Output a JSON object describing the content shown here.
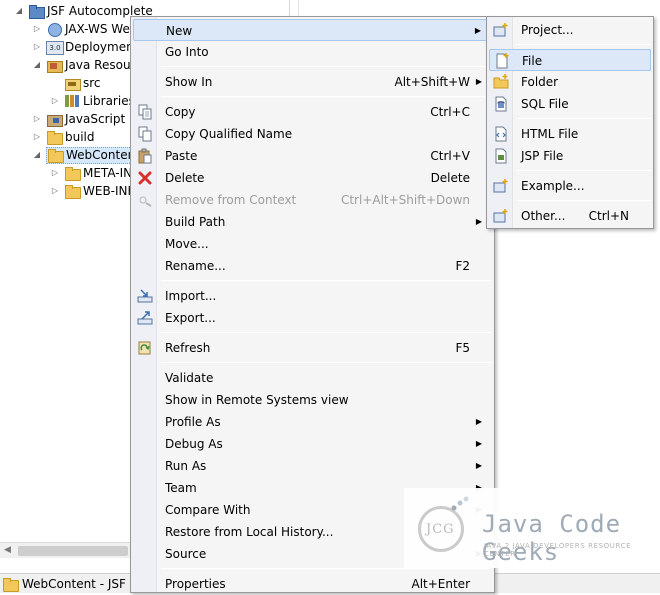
{
  "explorer": {
    "items": [
      {
        "label": "JSF Autocomplete",
        "icon": "project-icon",
        "expanded": true
      },
      {
        "label": "JAX-WS Web",
        "icon": "web-service-icon",
        "expanded": false
      },
      {
        "label": "Deployment",
        "icon": "deployment-descriptor-icon",
        "expanded": false
      },
      {
        "label": "Java Resourc",
        "icon": "java-resources-icon",
        "expanded": true
      },
      {
        "label": "src",
        "icon": "source-folder-icon",
        "expanded": null
      },
      {
        "label": "Libraries",
        "icon": "libraries-icon",
        "expanded": false
      },
      {
        "label": "JavaScript R",
        "icon": "javascript-resources-icon",
        "expanded": false
      },
      {
        "label": "build",
        "icon": "folder-icon",
        "expanded": false
      },
      {
        "label": "WebConten",
        "icon": "folder-icon",
        "expanded": true,
        "selected": true
      },
      {
        "label": "META-IN",
        "icon": "folder-icon",
        "expanded": false
      },
      {
        "label": "WEB-INF",
        "icon": "folder-icon",
        "expanded": false
      }
    ]
  },
  "statusbar": {
    "text": "WebContent - JSF Aut"
  },
  "context_menu": {
    "items": [
      {
        "label": "New",
        "submenu": true,
        "highlighted": true
      },
      {
        "label": "Go Into"
      },
      {
        "label": "Show In",
        "shortcut": "Alt+Shift+W",
        "submenu": true
      },
      {
        "label": "Copy",
        "shortcut": "Ctrl+C",
        "icon": "copy-icon"
      },
      {
        "label": "Copy Qualified Name",
        "icon": "copy-qualified-name-icon"
      },
      {
        "label": "Paste",
        "shortcut": "Ctrl+V",
        "icon": "paste-icon"
      },
      {
        "label": "Delete",
        "shortcut": "Delete",
        "icon": "delete-icon"
      },
      {
        "label": "Remove from Context",
        "shortcut": "Ctrl+Alt+Shift+Down",
        "icon": "remove-context-icon",
        "disabled": true
      },
      {
        "label": "Build Path",
        "submenu": true
      },
      {
        "label": "Move..."
      },
      {
        "label": "Rename...",
        "shortcut": "F2"
      },
      {
        "label": "Import...",
        "icon": "import-icon"
      },
      {
        "label": "Export...",
        "icon": "export-icon"
      },
      {
        "label": "Refresh",
        "shortcut": "F5",
        "icon": "refresh-icon"
      },
      {
        "label": "Validate"
      },
      {
        "label": "Show in Remote Systems view"
      },
      {
        "label": "Profile As",
        "submenu": true
      },
      {
        "label": "Debug As",
        "submenu": true
      },
      {
        "label": "Run As",
        "submenu": true
      },
      {
        "label": "Team",
        "submenu": true
      },
      {
        "label": "Compare With",
        "submenu": true
      },
      {
        "label": "Restore from Local History..."
      },
      {
        "label": "Source",
        "submenu": true
      },
      {
        "label": "Properties",
        "shortcut": "Alt+Enter"
      }
    ]
  },
  "new_submenu": {
    "items": [
      {
        "label": "Project...",
        "icon": "new-project-icon"
      },
      {
        "label": "File",
        "icon": "new-file-icon",
        "highlighted": true
      },
      {
        "label": "Folder",
        "icon": "new-folder-icon"
      },
      {
        "label": "SQL File",
        "icon": "sql-file-icon"
      },
      {
        "label": "HTML File",
        "icon": "html-file-icon"
      },
      {
        "label": "JSP File",
        "icon": "jsp-file-icon"
      },
      {
        "label": "Example...",
        "icon": "example-icon"
      },
      {
        "label": "Other...",
        "shortcut": "Ctrl+N",
        "icon": "other-wizard-icon"
      }
    ]
  },
  "watermark": {
    "initials": "JCG",
    "title": "Java Code Geeks",
    "tagline": "JAVA 2 JAVA DEVELOPERS RESOURCE CENTER"
  }
}
